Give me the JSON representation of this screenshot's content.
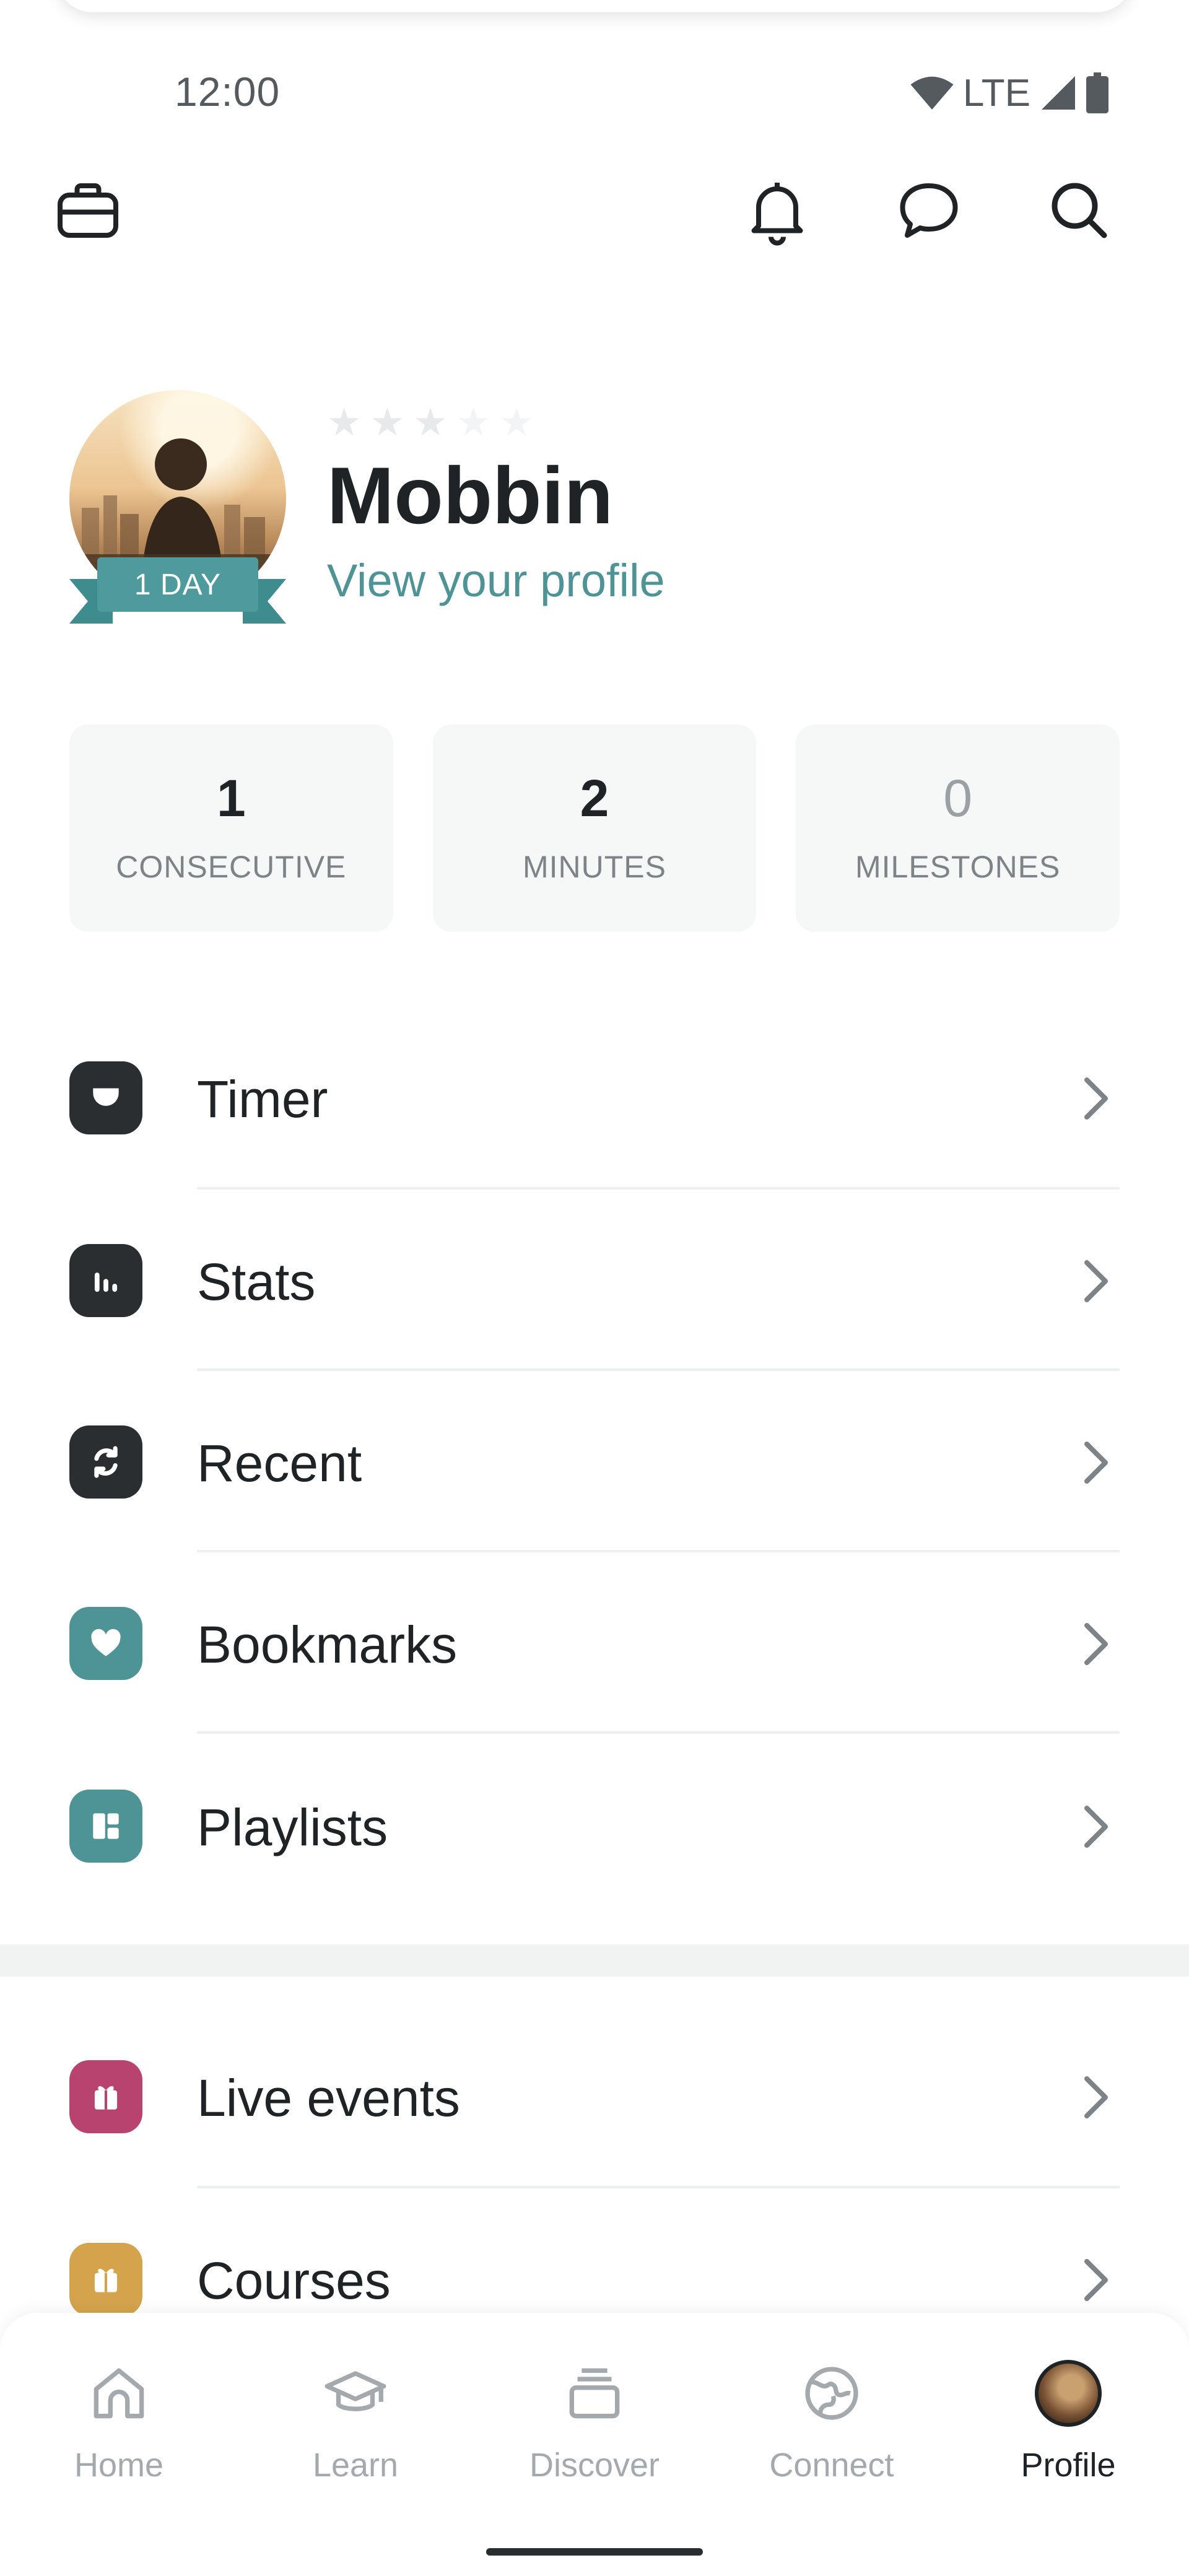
{
  "status_bar": {
    "time": "12:00",
    "network": "LTE"
  },
  "app_bar": {
    "briefcase_icon": "briefcase-icon",
    "bell_icon": "bell-icon",
    "chat_icon": "chat-bubble-icon",
    "search_icon": "search-icon"
  },
  "profile": {
    "name": "Mobbin",
    "link_text": "View your profile",
    "streak_badge": "1 DAY",
    "rating": 0,
    "rating_max": 5
  },
  "stats": [
    {
      "value": "1",
      "label": "CONSECUTIVE"
    },
    {
      "value": "2",
      "label": "MINUTES"
    },
    {
      "value": "0",
      "label": "MILESTONES"
    }
  ],
  "menu": {
    "timer": {
      "label": "Timer",
      "icon": "timer-icon",
      "color": "#2b2e30"
    },
    "stats": {
      "label": "Stats",
      "icon": "bar-chart-icon",
      "color": "#2b2e30"
    },
    "recent": {
      "label": "Recent",
      "icon": "refresh-icon",
      "color": "#2b2e30"
    },
    "bookmarks": {
      "label": "Bookmarks",
      "icon": "heart-icon",
      "color": "#4e9496"
    },
    "playlists": {
      "label": "Playlists",
      "icon": "playlist-icon",
      "color": "#4e9496"
    },
    "live_events": {
      "label": "Live events",
      "icon": "gift-icon",
      "color": "#b8436e"
    },
    "courses": {
      "label": "Courses",
      "icon": "gift-icon",
      "color": "#d4a34c"
    }
  },
  "bottom_nav": {
    "home": "Home",
    "learn": "Learn",
    "discover": "Discover",
    "connect": "Connect",
    "profile": "Profile",
    "active": "Profile"
  },
  "colors": {
    "accent_teal": "#4e9496",
    "text_dark": "#1f2326",
    "text_muted": "#7d8387"
  }
}
